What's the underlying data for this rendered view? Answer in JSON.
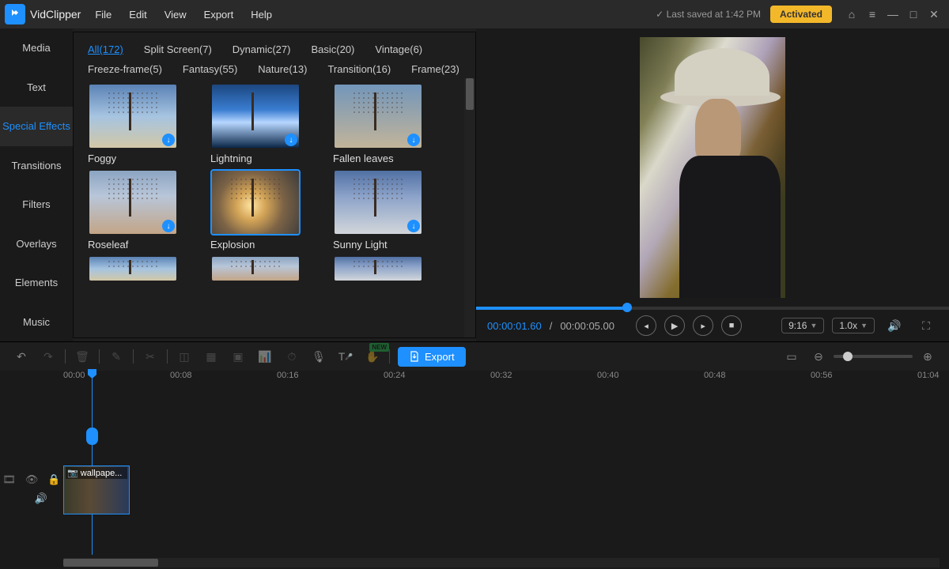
{
  "app": {
    "name": "VidClipper"
  },
  "menu": [
    "File",
    "Edit",
    "View",
    "Export",
    "Help"
  ],
  "titlebar": {
    "saved": "Last saved at 1:42 PM",
    "saved_prefix_icon": "✓",
    "activated": "Activated"
  },
  "side_tabs": [
    "Media",
    "Text",
    "Special Effects",
    "Transitions",
    "Filters",
    "Overlays",
    "Elements",
    "Music"
  ],
  "side_active_index": 2,
  "categories": [
    {
      "label": "All",
      "count": 172,
      "active": true
    },
    {
      "label": "Split Screen",
      "count": 7
    },
    {
      "label": "Dynamic",
      "count": 27
    },
    {
      "label": "Basic",
      "count": 20
    },
    {
      "label": "Vintage",
      "count": 6
    },
    {
      "label": "Freeze-frame",
      "count": 5
    },
    {
      "label": "Fantasy",
      "count": 55
    },
    {
      "label": "Nature",
      "count": 13
    },
    {
      "label": "Transition",
      "count": 16
    },
    {
      "label": "Frame",
      "count": 23
    }
  ],
  "effects": [
    {
      "name": "Foggy",
      "klass": "sky1 trunk branches",
      "download": true
    },
    {
      "name": "Lightning",
      "klass": "lightning trunk",
      "download": true
    },
    {
      "name": "Fallen leaves",
      "klass": "fall trunk branches",
      "download": true
    },
    {
      "name": "Roseleaf",
      "klass": "rose trunk branches",
      "download": true
    },
    {
      "name": "Explosion",
      "klass": "explode trunk branches",
      "selected": true
    },
    {
      "name": "Sunny Light",
      "klass": "sunny trunk branches",
      "download": true
    },
    {
      "name": "",
      "klass": "sky1 trunk branches",
      "partial": true
    },
    {
      "name": "",
      "klass": "rose trunk branches",
      "partial": true
    },
    {
      "name": "",
      "klass": "sunny trunk branches",
      "partial": true
    }
  ],
  "preview": {
    "current_time": "00:00:01.60",
    "total_time": "00:00:05.00",
    "ratio": "9:16",
    "speed": "1.0x"
  },
  "timeline": {
    "export_label": "Export",
    "ticks": [
      "00:00",
      "00:08",
      "00:16",
      "00:24",
      "00:32",
      "00:40",
      "00:48",
      "00:56",
      "01:04"
    ],
    "clip_label": "wallpape..."
  }
}
